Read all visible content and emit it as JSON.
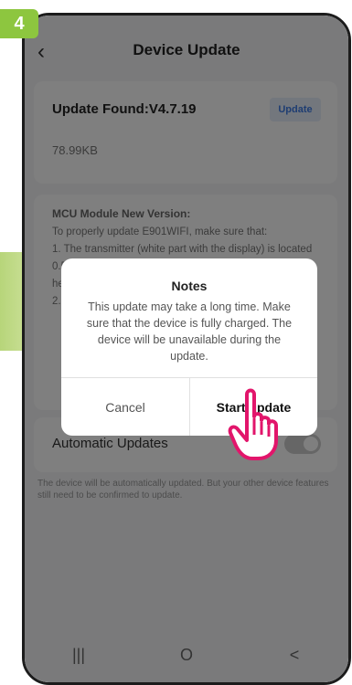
{
  "step": "4",
  "header": {
    "title": "Device Update",
    "back_icon": "chevron-left"
  },
  "update": {
    "found_label": "Update Found:V4.7.19",
    "button_label": "Update",
    "size": "78.99KB"
  },
  "mcu": {
    "title": "MCU Module New Version:",
    "body": "To properly update E901WIFI, make sure that:\n1. The transmitter (white part with the display) is located 0.5m-1m from the receiver (black part connected to the heating device)\n2. ..."
  },
  "auto_update": {
    "label": "Automatic Updates",
    "description": "The device will be automatically updated. But your other device features still need to be confirmed to update."
  },
  "dialog": {
    "title": "Notes",
    "message": "This update may take a long time. Make sure that the device is fully charged. The device will be unavailable during the update.",
    "cancel_label": "Cancel",
    "start_label": "Start update"
  },
  "navbar": {
    "recent": "|||",
    "home": "O",
    "back": "<"
  },
  "colors": {
    "accent_green": "#8dc63f",
    "link_blue": "#3d7be4",
    "pointer_pink": "#e2156b"
  }
}
